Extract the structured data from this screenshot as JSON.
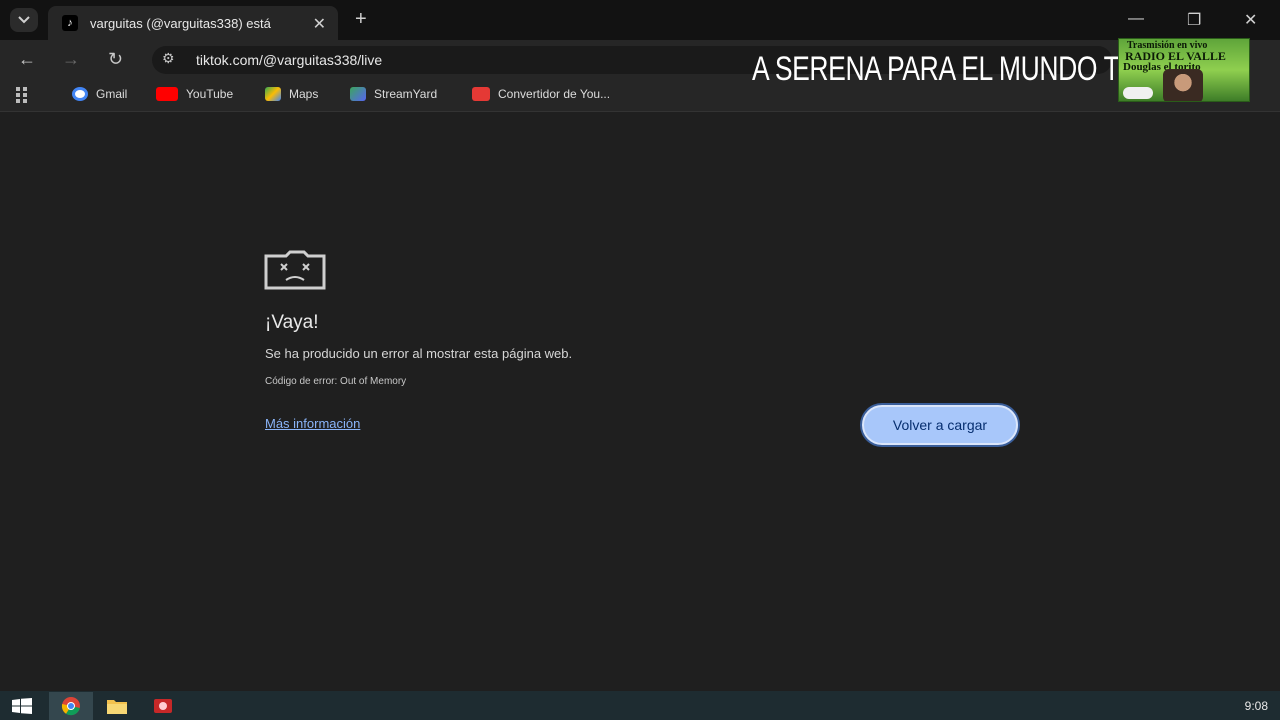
{
  "tab": {
    "title": "varguitas (@varguitas338) está",
    "favicon": "tiktok-icon",
    "close_glyph": "✕",
    "new_tab_glyph": "+"
  },
  "window_controls": {
    "minimize": "—",
    "restore": "❐",
    "close": "✕"
  },
  "toolbar": {
    "back_glyph": "←",
    "forward_glyph": "→",
    "reload_glyph": "↻",
    "url": "tiktok.com/@varguitas338/live"
  },
  "bookmarks": [
    {
      "label": "Gmail",
      "icon": "google-icon",
      "color": "#4285f4"
    },
    {
      "label": "YouTube",
      "icon": "youtube-icon",
      "color": "#ff0000"
    },
    {
      "label": "Maps",
      "icon": "maps-icon",
      "color": "#34a853"
    },
    {
      "label": "StreamYard",
      "icon": "streamyard-icon",
      "color": "#3ba55d"
    },
    {
      "label": "Convertidor de You...",
      "icon": "download-icon",
      "color": "#e53935"
    }
  ],
  "overlay": {
    "banner_text": "A SERENA PARA EL MUNDO T",
    "logo_line1": "Trasmisión en vivo",
    "logo_line2": "RADIO EL VALLE",
    "logo_line3": "Douglas el torito"
  },
  "error_page": {
    "title": "¡Vaya!",
    "message": "Se ha producido un error al mostrar esta página web.",
    "code": "Código de error: Out of Memory",
    "more_info": "Más información",
    "reload_button": "Volver a cargar"
  },
  "taskbar": {
    "clock": "9:08",
    "items": [
      "windows-start-icon",
      "chrome-icon",
      "file-explorer-icon",
      "app-icon"
    ]
  },
  "colors": {
    "accent_button": "#a8c7fa",
    "link": "#8ab4f8",
    "background": "#1f1f1f"
  }
}
